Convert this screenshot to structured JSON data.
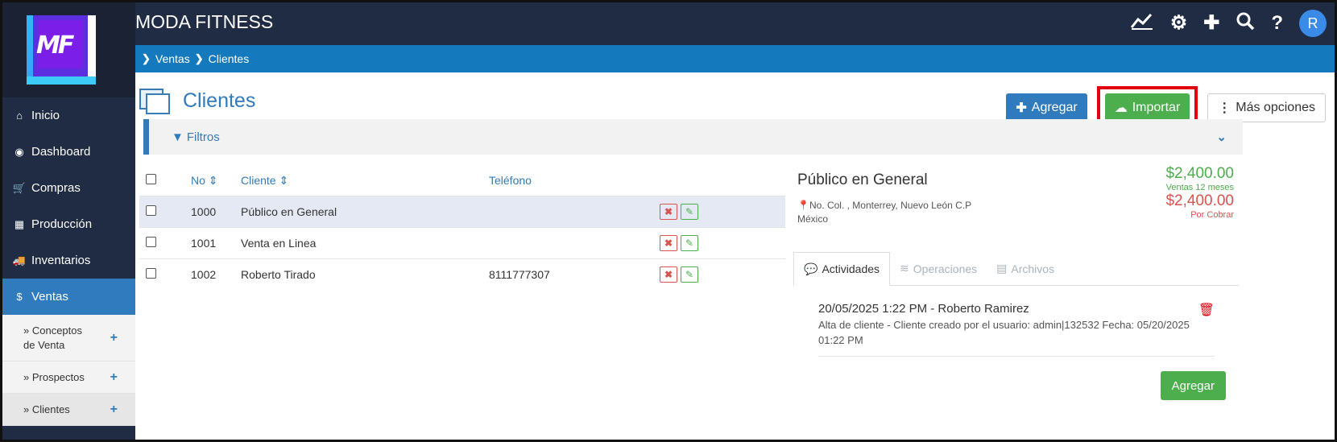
{
  "app": {
    "title": "MODA FITNESS",
    "logo_text": "MF",
    "avatar_initial": "R"
  },
  "top_icons": [
    {
      "name": "chart-icon",
      "glyph": "📈"
    },
    {
      "name": "gear-icon",
      "glyph": "⚙"
    },
    {
      "name": "plus-icon",
      "glyph": "✚"
    },
    {
      "name": "search-icon",
      "glyph": "🔍"
    },
    {
      "name": "help-icon",
      "glyph": "?"
    }
  ],
  "breadcrumb": [
    "Ventas",
    "Clientes"
  ],
  "sidebar": {
    "items": [
      {
        "label": "Inicio",
        "icon": "home-icon",
        "glyph": "⌂"
      },
      {
        "label": "Dashboard",
        "icon": "dashboard-icon",
        "glyph": "◉"
      },
      {
        "label": "Compras",
        "icon": "cart-icon",
        "glyph": "🛒"
      },
      {
        "label": "Producción",
        "icon": "production-icon",
        "glyph": "▦"
      },
      {
        "label": "Inventarios",
        "icon": "truck-icon",
        "glyph": "🚚"
      },
      {
        "label": "Ventas",
        "icon": "sales-icon",
        "glyph": "$"
      }
    ],
    "subitems": [
      {
        "label": "» Conceptos de Venta"
      },
      {
        "label": "» Prospectos"
      },
      {
        "label": "» Clientes"
      }
    ]
  },
  "page": {
    "title": "Clientes"
  },
  "actions": {
    "add": "Agregar",
    "import": "Importar",
    "more": "Más opciones"
  },
  "filters": {
    "label": "Filtros"
  },
  "table": {
    "headers": {
      "no": "No",
      "client": "Cliente",
      "phone": "Teléfono"
    },
    "rows": [
      {
        "no": "1000",
        "client": "Público en General",
        "phone": ""
      },
      {
        "no": "1001",
        "client": "Venta en Linea",
        "phone": ""
      },
      {
        "no": "1002",
        "client": "Roberto Tirado",
        "phone": "8111777307"
      }
    ]
  },
  "detail": {
    "name": "Público en General",
    "address_line1": "No. Col. , Monterrey, Nuevo León C.P",
    "address_line2": "México",
    "sales_value": "$2,400.00",
    "sales_label": "Ventas 12 meses",
    "due_value": "$2,400.00",
    "due_label": "Por Cobrar",
    "tabs": [
      "Actividades",
      "Operaciones",
      "Archivos"
    ],
    "activity": {
      "title": "20/05/2025 1:22 PM - Roberto Ramirez",
      "desc": "Alta de cliente - Cliente creado por el usuario: admin|132532 Fecha: 05/20/2025 01:22 PM"
    },
    "add_label": "Agregar"
  }
}
